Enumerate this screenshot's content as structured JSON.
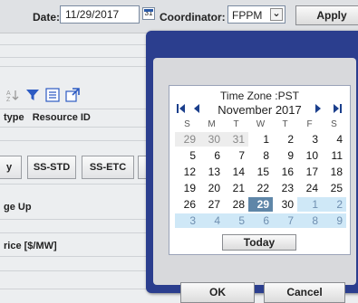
{
  "toolbar": {
    "date_label": "Date:",
    "date_value": "11/29/2017",
    "calendar_icon_text": "31",
    "coordinator_label": "Coordinator:",
    "coordinator_value": "FPPM",
    "apply_label": "Apply"
  },
  "panel": {
    "columns": [
      "type",
      "Resource ID"
    ],
    "tabs": [
      "y",
      "SS-STD",
      "SS-ETC"
    ],
    "section1": "ge Up",
    "section2": "rice [$/MW]"
  },
  "calendar": {
    "timezone_title": "Time Zone :PST",
    "month_title": "November 2017",
    "weekdays": [
      "S",
      "M",
      "T",
      "W",
      "T",
      "F",
      "S"
    ],
    "weeks": [
      [
        "29",
        "30",
        "31",
        "1",
        "2",
        "3",
        "4"
      ],
      [
        "5",
        "6",
        "7",
        "8",
        "9",
        "10",
        "11"
      ],
      [
        "12",
        "13",
        "14",
        "15",
        "16",
        "17",
        "18"
      ],
      [
        "19",
        "20",
        "21",
        "22",
        "23",
        "24",
        "25"
      ],
      [
        "26",
        "27",
        "28",
        "29",
        "30",
        "1",
        "2"
      ],
      [
        "3",
        "4",
        "5",
        "6",
        "7",
        "8",
        "9"
      ]
    ],
    "selected_date": "29",
    "today_label": "Today"
  },
  "dialog": {
    "ok_label": "OK",
    "cancel_label": "Cancel"
  },
  "colors": {
    "popup_frame": "#2b3e8e",
    "selected_day": "#5f86a8",
    "next_month_cells": "#cfe8f7"
  }
}
